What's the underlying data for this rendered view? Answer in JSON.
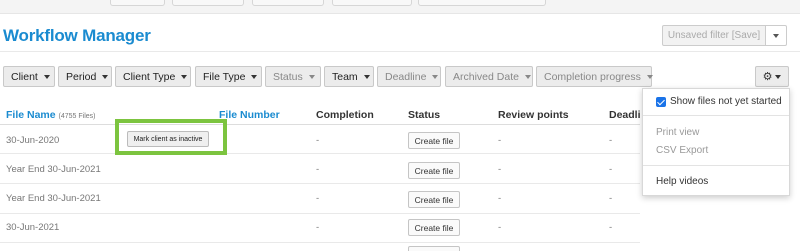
{
  "header": {
    "title": "Workflow Manager",
    "save_filter_label": "Unsaved filter [Save]"
  },
  "filters": [
    {
      "label": "Client",
      "enabled": true
    },
    {
      "label": "Period",
      "enabled": true
    },
    {
      "label": "Client Type",
      "enabled": true
    },
    {
      "label": "File Type",
      "enabled": true
    },
    {
      "label": "Status",
      "enabled": false
    },
    {
      "label": "Team",
      "enabled": true
    },
    {
      "label": "Deadline",
      "enabled": false
    },
    {
      "label": "Archived Date",
      "enabled": false
    },
    {
      "label": "Completion progress",
      "enabled": false
    }
  ],
  "table": {
    "columns": {
      "file_name": "File Name",
      "file_count": "(4755 Files)",
      "file_number": "File Number",
      "completion": "Completion",
      "status": "Status",
      "review_points": "Review points",
      "deadline": "Deadli"
    },
    "rows": [
      {
        "file_name": "30-Jun-2020",
        "completion": "-",
        "action": "Create file",
        "review_points": "-",
        "deadline": "-"
      },
      {
        "file_name": "Year End 30-Jun-2021",
        "completion": "-",
        "action": "Create file",
        "review_points": "-",
        "deadline": "-"
      },
      {
        "file_name": "Year End 30-Jun-2021",
        "completion": "-",
        "action": "Create file",
        "review_points": "-",
        "deadline": "-"
      },
      {
        "file_name": "30-Jun-2021",
        "completion": "-",
        "action": "Create file",
        "review_points": "-",
        "deadline": "-"
      }
    ],
    "row_action_label": "Mark client as inactive"
  },
  "gear_menu": {
    "show_not_started": {
      "label": "Show files not yet started",
      "checked": true
    },
    "print_view": "Print view",
    "csv_export": "CSV Export",
    "help_videos": "Help videos"
  },
  "colors": {
    "accent": "#1a8bd0",
    "highlight": "#7cc43f",
    "checkbox": "#1a73e8"
  }
}
